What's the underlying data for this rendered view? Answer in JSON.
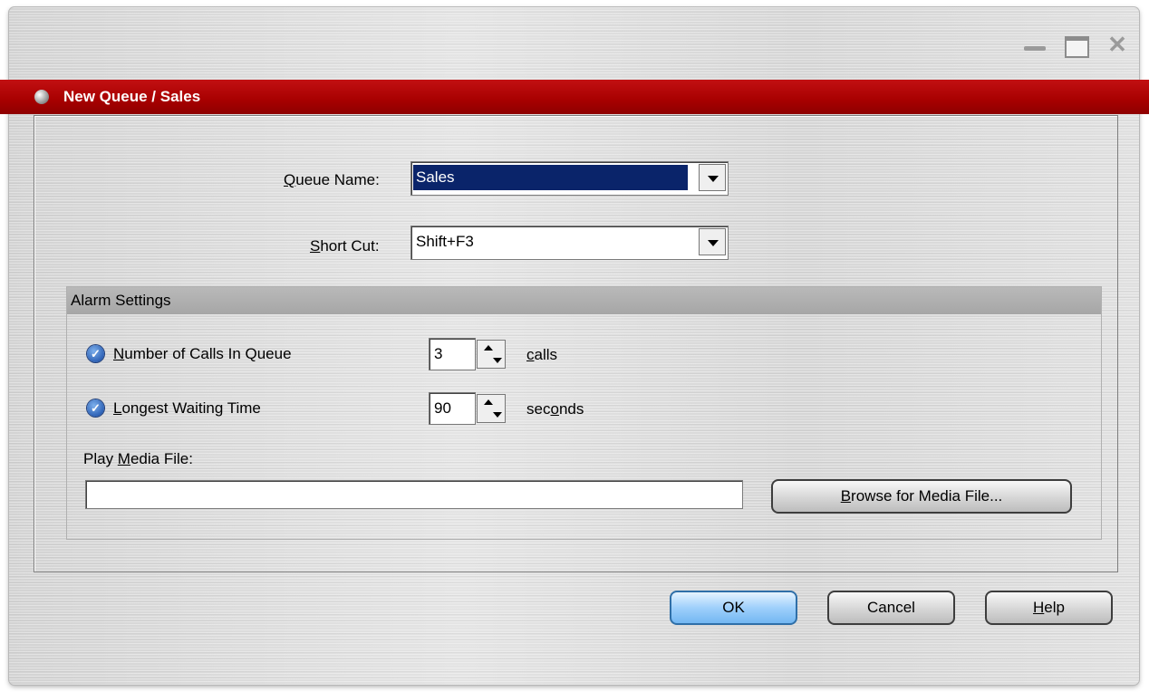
{
  "window": {
    "title": "New Queue / Sales",
    "accent_color": "#a70000",
    "controls": [
      "minimize-icon",
      "maximize-icon",
      "close-icon"
    ]
  },
  "form": {
    "queue_name": {
      "label_before": "",
      "label_mnemonic": "Q",
      "label_after": "ueue Name:",
      "value": "Sales"
    },
    "short_cut": {
      "label_before": "",
      "label_mnemonic": "S",
      "label_after": "hort Cut:",
      "value": "Shift+F3"
    }
  },
  "alarm": {
    "header": "Alarm Settings",
    "calls": {
      "checked": true,
      "label_before": "",
      "label_mnemonic": "N",
      "label_after": "umber of Calls In Queue",
      "value": "3",
      "unit_before": "",
      "unit_mnemonic": "c",
      "unit_after": "alls"
    },
    "wait": {
      "checked": true,
      "label_before": "",
      "label_mnemonic": "L",
      "label_after": "ongest Waiting Time",
      "value": "90",
      "unit_before": "sec",
      "unit_mnemonic": "o",
      "unit_after": "nds"
    },
    "media": {
      "label_before": "Play ",
      "label_mnemonic": "M",
      "label_after": "edia File:",
      "value": "",
      "browse_before": "",
      "browse_mnemonic": "B",
      "browse_after": "rowse for Media File..."
    }
  },
  "buttons": {
    "ok": "OK",
    "cancel": "Cancel",
    "help_before": "",
    "help_mnemonic": "H",
    "help_after": "elp"
  }
}
